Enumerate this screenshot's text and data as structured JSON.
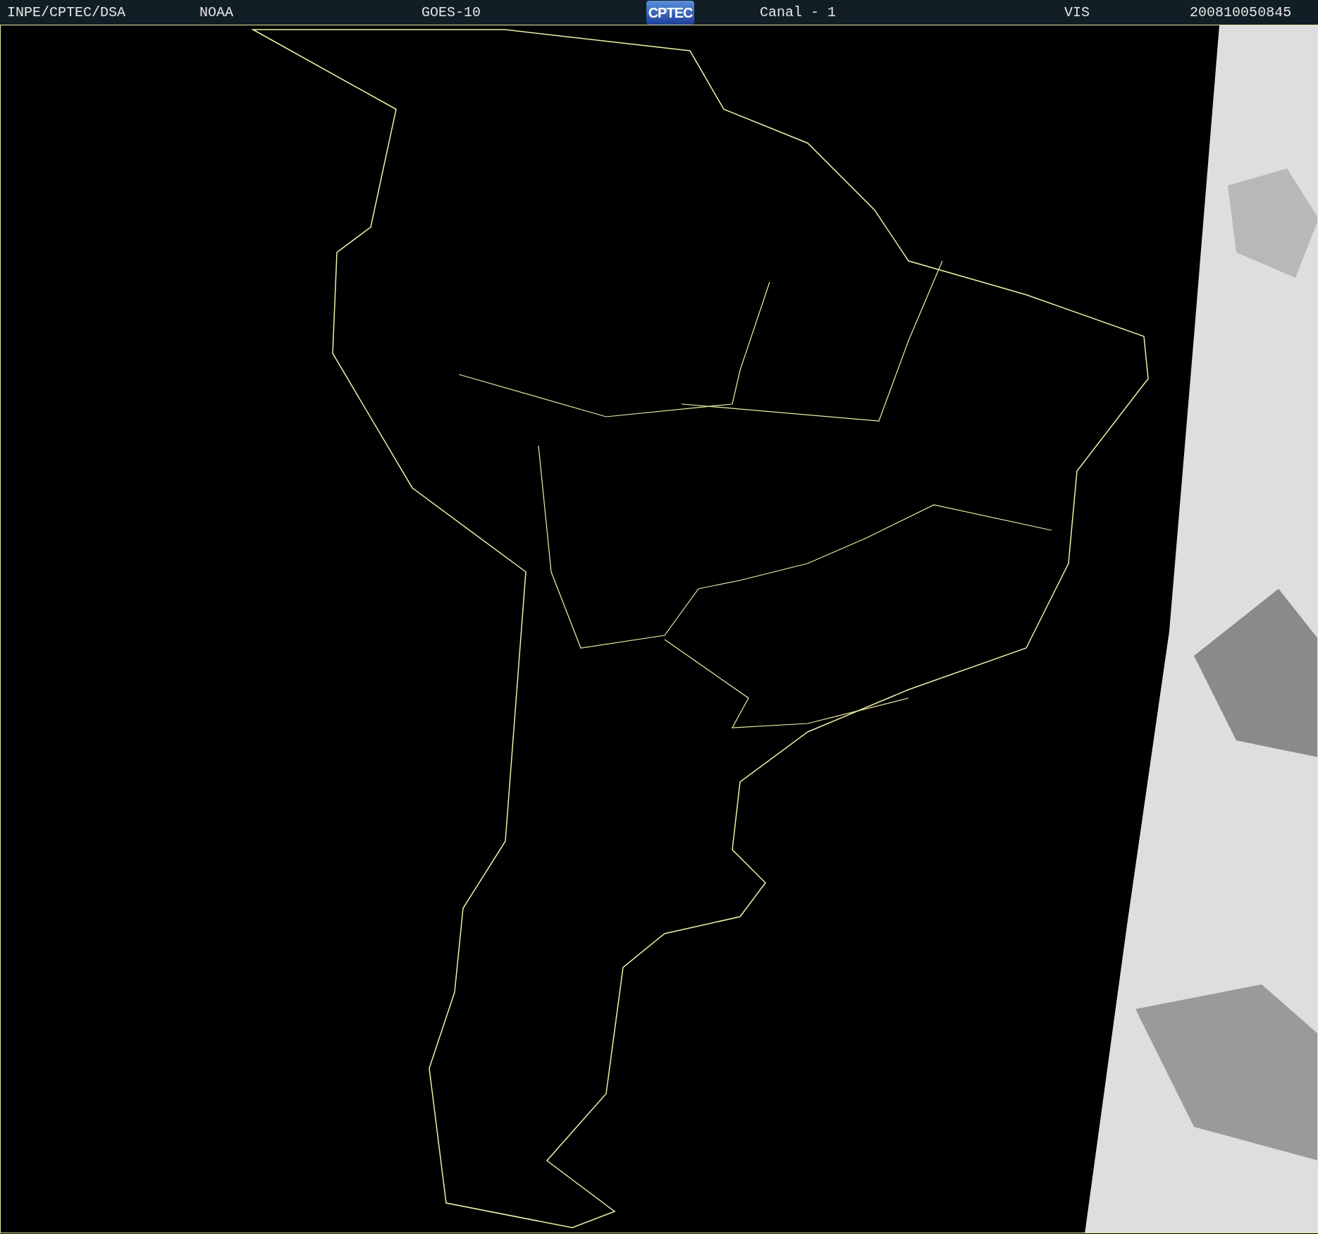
{
  "header": {
    "items": [
      {
        "kind": "text",
        "text": "INPE/CPTEC/DSA"
      },
      {
        "kind": "text",
        "text": "NOAA"
      },
      {
        "kind": "text",
        "text": "GOES-10"
      },
      {
        "kind": "logo",
        "text": "CPTEC"
      },
      {
        "kind": "text",
        "text": "Canal - 1"
      },
      {
        "kind": "text",
        "text": "VIS"
      },
      {
        "kind": "text",
        "text": "200810050845"
      }
    ]
  }
}
